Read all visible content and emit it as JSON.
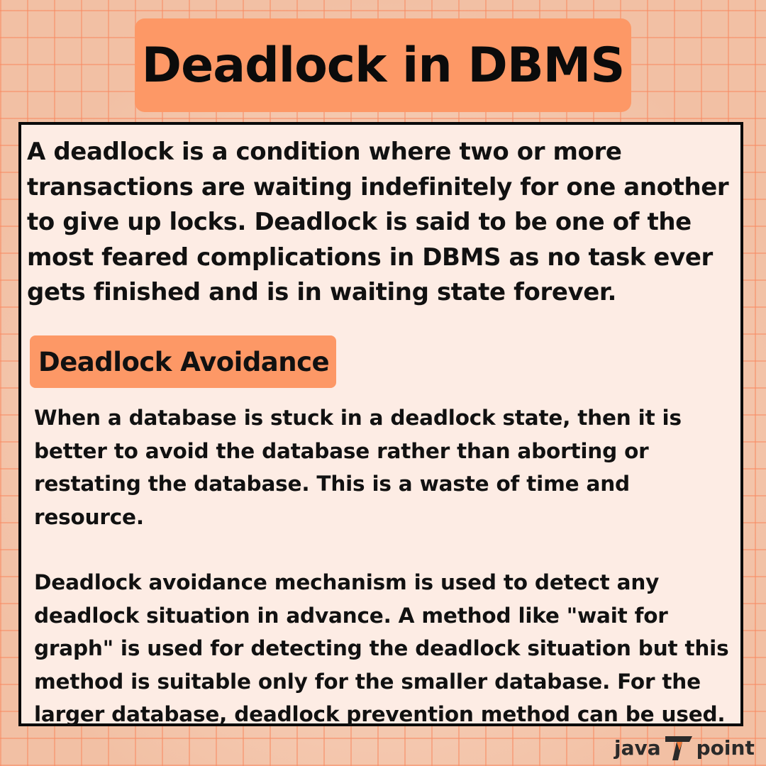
{
  "title": "Deadlock in DBMS",
  "intro": "A deadlock is a condition where two or more transactions are waiting indefinitely for one another to give up locks. Deadlock is said to be one of the most feared complications in DBMS as no task ever gets finished and is in waiting state forever.",
  "section": {
    "heading": "Deadlock Avoidance",
    "paragraphs": [
      "When a database is stuck in a deadlock state, then it is better to avoid the database rather than aborting or restating the database. This is a waste of time and resource.",
      "Deadlock avoidance mechanism is used to detect any deadlock situation in advance. A method like \"wait for graph\" is used for detecting the deadlock situation but this method is suitable only for the smaller database. For the larger database, deadlock prevention method can be used."
    ]
  },
  "logo": {
    "left": "java",
    "right": "point",
    "icon": "javatpoint-t-icon"
  },
  "colors": {
    "accent": "#fd9866",
    "card_bg": "#fdece4",
    "background": "#f4c7ad",
    "text": "#111111"
  }
}
